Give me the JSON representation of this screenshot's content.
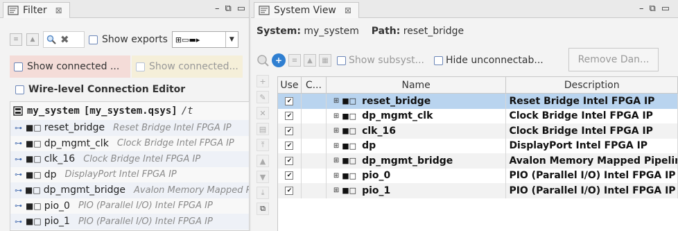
{
  "filter_panel": {
    "tab_label": "Filter",
    "tab_close": "⊠",
    "window_controls": [
      "–",
      "⧉",
      "▭"
    ],
    "show_exports_label": "Show exports",
    "combo_value": "⊞▭▬▸",
    "show_connected_1": "Show connected ...",
    "show_connected_2": "Show connected...",
    "wire_level_label": "Wire-level Connection Editor",
    "tree": {
      "root_name": "my_system",
      "root_file": "[my_system.qsys]",
      "root_tail": "/t",
      "items": [
        {
          "name": "reset_bridge",
          "desc": "Reset Bridge Intel FPGA IP"
        },
        {
          "name": "dp_mgmt_clk",
          "desc": "Clock Bridge Intel FPGA IP"
        },
        {
          "name": "clk_16",
          "desc": "Clock Bridge Intel FPGA IP"
        },
        {
          "name": "dp",
          "desc": "DisplayPort Intel FPGA IP"
        },
        {
          "name": "dp_mgmt_bridge",
          "desc": "Avalon Memory Mapped Pipeline Bridge Intel FPGA IP"
        },
        {
          "name": "pio_0",
          "desc": "PIO (Parallel I/O) Intel FPGA IP"
        },
        {
          "name": "pio_1",
          "desc": "PIO (Parallel I/O) Intel FPGA IP"
        }
      ]
    }
  },
  "system_view": {
    "tab_label": "System View",
    "tab_close": "⊠",
    "window_controls": [
      "–",
      "⧉",
      "▭"
    ],
    "system_label": "System:",
    "system_value": "my_system",
    "path_label": "Path:",
    "path_value": "reset_bridge",
    "show_subsystems": "Show subsyst...",
    "hide_unconnectable": "Hide unconnectab...",
    "remove_button": "Remove Dan...",
    "columns": {
      "use": "Use",
      "c": "C...",
      "name": "Name",
      "description": "Description"
    },
    "rows": [
      {
        "name": "reset_bridge",
        "description": "Reset Bridge Intel FPGA IP",
        "selected": true
      },
      {
        "name": "dp_mgmt_clk",
        "description": "Clock Bridge Intel FPGA IP"
      },
      {
        "name": "clk_16",
        "description": "Clock Bridge Intel FPGA IP"
      },
      {
        "name": "dp",
        "description": "DisplayPort Intel FPGA IP"
      },
      {
        "name": "dp_mgmt_bridge",
        "description": "Avalon Memory Mapped Pipeline Bridge Intel FPGA IP"
      },
      {
        "name": "pio_0",
        "description": "PIO (Parallel I/O) Intel FPGA IP"
      },
      {
        "name": "pio_1",
        "description": "PIO (Parallel I/O) Intel FPGA IP"
      }
    ],
    "checkmark": "✔"
  }
}
